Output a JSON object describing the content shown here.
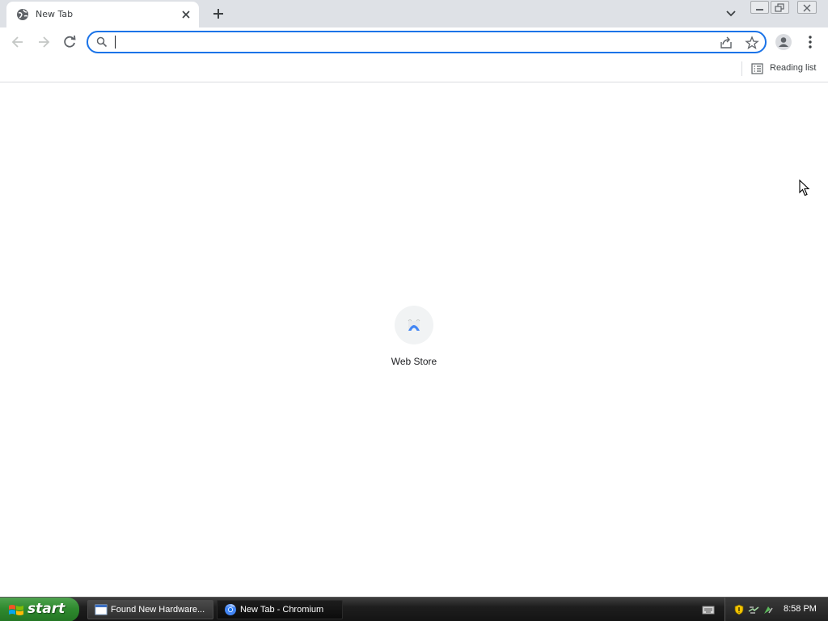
{
  "browser": {
    "tab": {
      "title": "New Tab",
      "favicon": "globe-icon"
    },
    "window_controls": [
      "minimize-icon",
      "restore-icon",
      "close-icon"
    ],
    "omnibox": {
      "value": "",
      "placeholder": ""
    },
    "bookmarks_bar": {
      "reading_list_label": "Reading list"
    }
  },
  "new_tab_page": {
    "shortcuts": [
      {
        "label": "Web Store",
        "icon": "web-store-icon"
      }
    ]
  },
  "taskbar": {
    "start_label": "start",
    "tasks": [
      {
        "label": "Found New Hardware...",
        "icon": "window-icon",
        "active": false
      },
      {
        "label": "New Tab - Chromium",
        "icon": "chromium-icon",
        "active": true
      }
    ],
    "clock": "8:58 PM"
  },
  "colors": {
    "accent": "#1a73e8",
    "tabstrip": "#dee1e6",
    "start_green": "#2f8a2f",
    "taskbar": "#1e1e1e"
  }
}
